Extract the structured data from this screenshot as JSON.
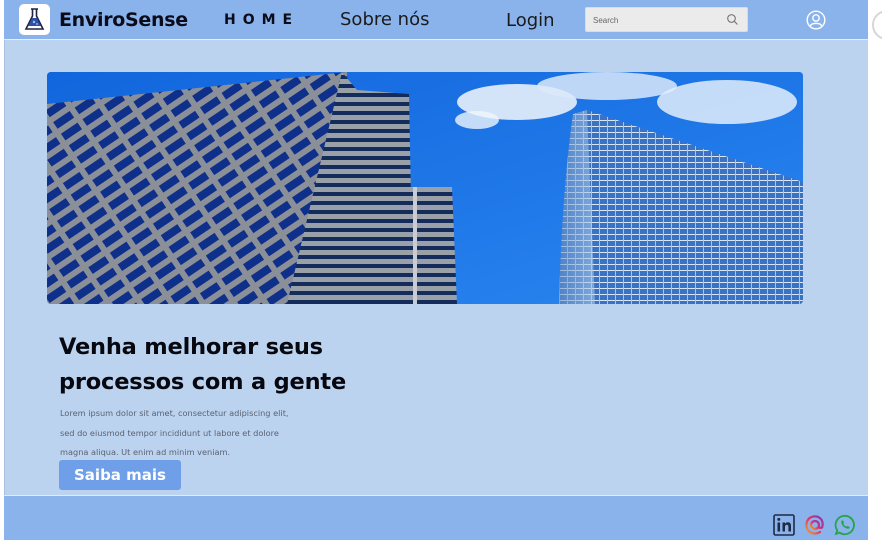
{
  "header": {
    "brand": "EnviroSense",
    "nav": {
      "home": "HOME",
      "about": "Sobre nós",
      "login": "Login"
    },
    "search": {
      "placeholder": "Search"
    },
    "icons": {
      "logo": "flask-logo-icon",
      "search": "search-icon",
      "user": "user-circle-icon"
    }
  },
  "hero": {
    "image": "skyscrapers-photo",
    "headline_line1": "Venha melhorar seus",
    "headline_line2": "processos com a gente",
    "body_line1": "Lorem ipsum dolor sit amet, consectetur adipiscing elit,",
    "body_line2": "sed do eiusmod tempor incididunt ut labore et dolore",
    "body_line3": "magna aliqua. Ut enim ad minim veniam.",
    "cta_label": "Saiba mais"
  },
  "footer": {
    "social": [
      "linkedin-icon",
      "threads-icon",
      "whatsapp-icon"
    ]
  },
  "colors": {
    "page_bg": "#bcd3f0",
    "header_bg": "#8ab3ec",
    "button_bg": "#6f9fe8",
    "text_dark": "#07070f"
  }
}
